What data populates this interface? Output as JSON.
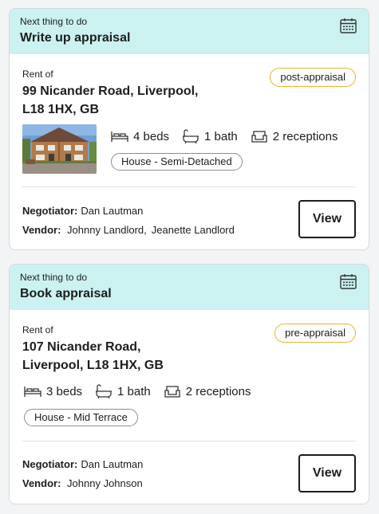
{
  "cards": [
    {
      "next_label": "Next thing to do",
      "task": "Write up appraisal",
      "rent_label": "Rent of",
      "address_line1": "99 Nicander Road, Liverpool,",
      "address_line2": "L18 1HX, GB",
      "status": "post-appraisal",
      "beds": "4 beds",
      "baths": "1 bath",
      "receptions": "2 receptions",
      "property_type": "House - Semi-Detached",
      "negotiator_label": "Negotiator:",
      "negotiator": "Dan Lautman",
      "vendor_label": "Vendor:",
      "vendors": [
        "Johnny Landlord,",
        "Jeanette Landlord"
      ],
      "view_label": "View"
    },
    {
      "next_label": "Next thing to do",
      "task": "Book appraisal",
      "rent_label": "Rent of",
      "address_line1": "107 Nicander Road,",
      "address_line2": "Liverpool, L18 1HX, GB",
      "status": "pre-appraisal",
      "beds": "3 beds",
      "baths": "1 bath",
      "receptions": "2 receptions",
      "property_type": "House - Mid Terrace",
      "negotiator_label": "Negotiator:",
      "negotiator": "Dan Lautman",
      "vendor_label": "Vendor:",
      "vendors": [
        "Johnny Johnson"
      ],
      "view_label": "View"
    }
  ],
  "colors": {
    "header_bg": "#cbf2f0",
    "badge_border": "#e5b82c",
    "tag_border": "#8a8f94"
  }
}
